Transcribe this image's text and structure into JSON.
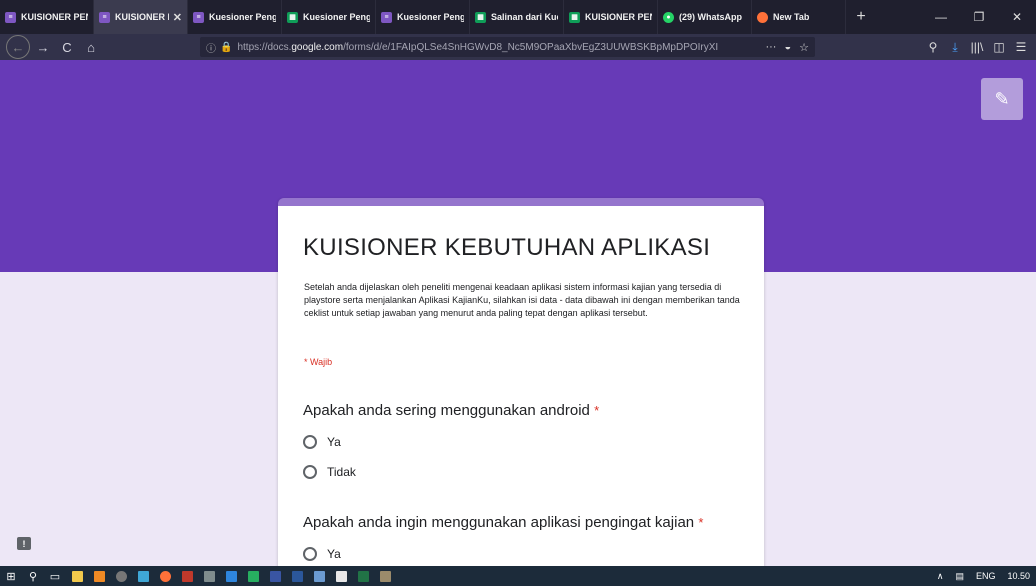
{
  "browser": {
    "tabs": [
      {
        "label": "KUISIONER PEN",
        "icon": "forms-icon",
        "active": false
      },
      {
        "label": "KUISIONER K",
        "icon": "forms-icon",
        "active": true
      },
      {
        "label": "Kuesioner Peng",
        "icon": "forms-icon",
        "active": false
      },
      {
        "label": "Kuesioner Peng",
        "icon": "sheets-icon",
        "active": false
      },
      {
        "label": "Kuesioner Peng",
        "icon": "forms-icon",
        "active": false
      },
      {
        "label": "Salinan dari Kue",
        "icon": "sheets-icon",
        "active": false
      },
      {
        "label": "KUISIONER PEN",
        "icon": "sheets-icon",
        "active": false
      },
      {
        "label": "(29) WhatsApp",
        "icon": "whatsapp-icon",
        "active": false
      },
      {
        "label": "New Tab",
        "icon": "firefox-icon",
        "active": false
      }
    ],
    "tab_close": "✕",
    "new_tab": "+",
    "window_controls": {
      "minimize": "—",
      "restore": "❐",
      "close": "✕"
    },
    "nav": {
      "back": "←",
      "forward": "→",
      "reload": "C",
      "home": "⌂"
    },
    "url": {
      "prefix": "https://docs.",
      "host": "google.com",
      "path": "/forms/d/e/1FAIpQLSe4SnHGWvD8_Nc5M9OPaaXbvEgZ3UUWBSKBpMpDPOIryXI",
      "actions": "···"
    },
    "nav_right": {
      "library": "|||\\",
      "sidebar": "◫",
      "menu": "☰"
    }
  },
  "form": {
    "title": "KUISIONER KEBUTUHAN APLIKASI",
    "description": "Setelah anda dijelaskan oleh peneliti mengenai keadaan aplikasi sistem informasi kajian yang tersedia di playstore serta menjalankan Aplikasi KajianKu, silahkan isi data - data dibawah ini dengan memberikan tanda ceklist untuk setiap jawaban yang menurut anda paling tepat dengan aplikasi tersebut.",
    "required_note": "* Wajib",
    "questions": [
      {
        "title": "Apakah anda sering menggunakan android",
        "required_mark": "*",
        "options": [
          "Ya",
          "Tidak"
        ]
      },
      {
        "title": "Apakah anda ingin menggunakan aplikasi pengingat kajian",
        "required_mark": "*",
        "options": [
          "Ya"
        ]
      }
    ]
  },
  "taskbar": {
    "tray_chevron": "∧",
    "language": "ENG",
    "clock": "10.50"
  },
  "colors": {
    "banner": "#673ab7",
    "background": "#ede7f6",
    "accent": "#9575cd",
    "required": "#d93025"
  }
}
